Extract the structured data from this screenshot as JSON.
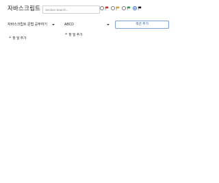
{
  "app": {
    "title": "자바스크립트"
  },
  "search": {
    "placeholder": "Section Search..."
  },
  "filters": [
    {
      "color": "#e02020",
      "icon": "flag-icon",
      "checked": false
    },
    {
      "color": "#f0a020",
      "icon": "flag-icon",
      "checked": false
    },
    {
      "color": "#20a040",
      "icon": "flag-icon",
      "checked": false
    },
    {
      "color": "#111111",
      "icon": "flag-icon",
      "checked": true
    }
  ],
  "sections": [
    {
      "title": "자바스크립트 문법 공부하기",
      "add_task_label": "할 일 추가",
      "add_task_icon": "plus-icon"
    },
    {
      "title": "ABCD",
      "add_task_label": "할 일 추가",
      "add_task_icon": "plus-icon"
    }
  ],
  "actions": {
    "add_section_label": "섹션 추가"
  }
}
